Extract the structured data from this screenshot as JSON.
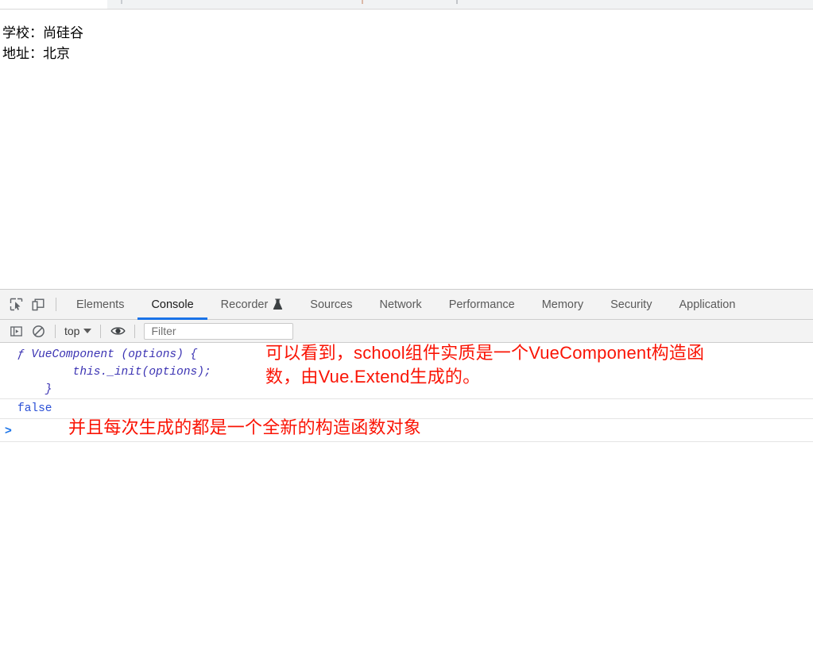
{
  "browser": {
    "omnibox_visible_sliver": true
  },
  "page": {
    "lines": [
      {
        "text": "学校：尚硅谷"
      },
      {
        "text": "地址：北京"
      }
    ]
  },
  "devtools": {
    "left_tools": [
      {
        "icon": "inspect-element-icon",
        "title": "Inspect element"
      },
      {
        "icon": "device-toolbar-icon",
        "title": "Toggle device toolbar"
      }
    ],
    "tabs": [
      {
        "label": "Elements",
        "active": false,
        "icon": null
      },
      {
        "label": "Console",
        "active": true,
        "icon": null
      },
      {
        "label": "Recorder",
        "active": false,
        "icon": "flask-icon"
      },
      {
        "label": "Sources",
        "active": false,
        "icon": null
      },
      {
        "label": "Network",
        "active": false,
        "icon": null
      },
      {
        "label": "Performance",
        "active": false,
        "icon": null
      },
      {
        "label": "Memory",
        "active": false,
        "icon": null
      },
      {
        "label": "Security",
        "active": false,
        "icon": null
      },
      {
        "label": "Application",
        "active": false,
        "icon": null
      }
    ],
    "active_tab": "Console",
    "accent_color": "#1a73e8",
    "console_toolbar": {
      "sidebar_toggle_icon": "console-sidebar-icon",
      "clear_console_icon": "clear-console-icon",
      "context_label": "top",
      "context_caret_icon": "chevron-down-icon",
      "live_expression_icon": "eye-icon",
      "filter_placeholder": "Filter",
      "filter_value": ""
    },
    "console_output": {
      "entries": [
        {
          "type": "function",
          "keyword": "ƒ",
          "lines": [
            "ƒ VueComponent (options) {",
            "        this._init(options);",
            "    }"
          ],
          "color": "#3b33b3"
        },
        {
          "type": "boolean",
          "value": "false",
          "color": "#2a4fd6"
        }
      ],
      "prompt_caret": ">"
    }
  },
  "annotations": [
    {
      "id": "annotation-one",
      "text": "可以看到，school组件实质是一个VueComponent构造函\n数，由Vue.Extend生成的。",
      "color": "#fa1405"
    },
    {
      "id": "annotation-two",
      "text": "并且每次生成的都是一个全新的构造函数对象",
      "color": "#fa1405"
    }
  ]
}
